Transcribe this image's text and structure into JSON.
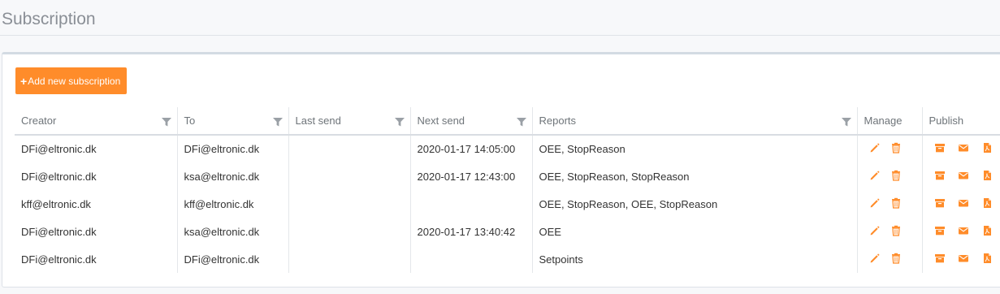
{
  "page": {
    "title": "Subscription"
  },
  "toolbar": {
    "add_button_label": "Add new subscription",
    "add_button_plus": "+"
  },
  "table": {
    "columns": [
      {
        "key": "creator",
        "label": "Creator",
        "filterable": true
      },
      {
        "key": "to",
        "label": "To",
        "filterable": true
      },
      {
        "key": "last_send",
        "label": "Last send",
        "filterable": true
      },
      {
        "key": "next_send",
        "label": "Next send",
        "filterable": true
      },
      {
        "key": "reports",
        "label": "Reports",
        "filterable": true
      },
      {
        "key": "manage",
        "label": "Manage",
        "filterable": false
      },
      {
        "key": "publish",
        "label": "Publish",
        "filterable": false
      }
    ],
    "rows": [
      {
        "creator": "DFi@eltronic.dk",
        "to": "DFi@eltronic.dk",
        "last_send": "",
        "next_send": "2020-01-17 14:05:00",
        "reports": "OEE, StopReason"
      },
      {
        "creator": "DFi@eltronic.dk",
        "to": "ksa@eltronic.dk",
        "last_send": "",
        "next_send": "2020-01-17 12:43:00",
        "reports": "OEE, StopReason, StopReason"
      },
      {
        "creator": "kff@eltronic.dk",
        "to": "kff@eltronic.dk",
        "last_send": "",
        "next_send": "",
        "reports": "OEE, StopReason, OEE, StopReason"
      },
      {
        "creator": "DFi@eltronic.dk",
        "to": "ksa@eltronic.dk",
        "last_send": "",
        "next_send": "2020-01-17 13:40:42",
        "reports": "OEE"
      },
      {
        "creator": "DFi@eltronic.dk",
        "to": "DFi@eltronic.dk",
        "last_send": "",
        "next_send": "",
        "reports": "Setpoints"
      }
    ],
    "manage_icons": [
      "pencil-icon",
      "trash-icon"
    ],
    "publish_icons": [
      "archive-icon",
      "envelope-icon",
      "pdf-file-icon"
    ]
  },
  "colors": {
    "accent": "#ff8c2a",
    "filter_icon": "#9aa0a6",
    "title": "#8a8f96"
  }
}
